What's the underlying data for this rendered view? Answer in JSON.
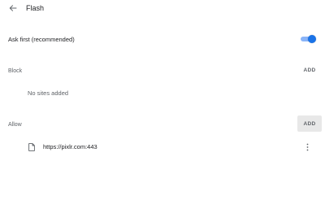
{
  "header": {
    "title": "Flash"
  },
  "ask_first": {
    "label": "Ask first (recommended)",
    "enabled": true,
    "accent": "#1a73e8"
  },
  "block": {
    "label": "Block",
    "add_label": "ADD",
    "empty_text": "No sites added"
  },
  "allow": {
    "label": "Allow",
    "add_label": "ADD",
    "sites": [
      {
        "url": "https://pixlr.com:443",
        "icon": "file-icon"
      }
    ]
  },
  "icons": {
    "back": "arrow-left-icon",
    "more": "more-vert-icon"
  }
}
